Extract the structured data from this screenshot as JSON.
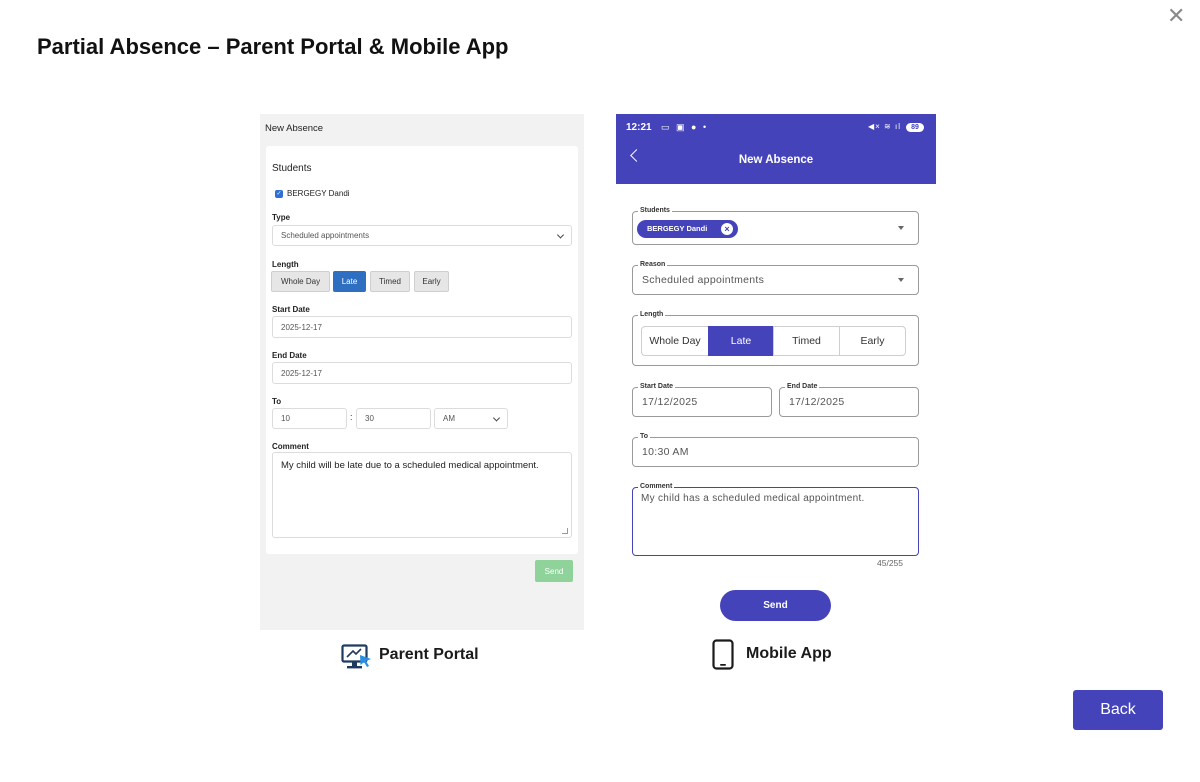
{
  "title": "Partial Absence – Parent Portal & Mobile App",
  "close_icon": "close-x-icon",
  "portal": {
    "heading": "New Absence",
    "students_label": "Students",
    "student_name": "BERGEGY Dandi",
    "type_label": "Type",
    "type_value": "Scheduled appointments",
    "length_label": "Length",
    "length_options": [
      "Whole Day",
      "Late",
      "Timed",
      "Early"
    ],
    "length_selected": "Late",
    "start_label": "Start Date",
    "start_value": "2025-12-17",
    "end_label": "End Date",
    "end_value": "2025-12-17",
    "to_label": "To",
    "to_hour": "10",
    "to_minute": "30",
    "to_ampm": "AM",
    "comment_label": "Comment",
    "comment_value": "My child will be late due to a scheduled medical appointment.",
    "send_label": "Send",
    "caption": "Parent Portal",
    "accent": "#2f6fc1",
    "send_color": "#8fd39a"
  },
  "mobile": {
    "status_time": "12:21",
    "battery": "89",
    "heading": "New Absence",
    "students_label": "Students",
    "student_chip": "BERGEGY Dandi",
    "reason_label": "Reason",
    "reason_value": "Scheduled appointments",
    "length_label": "Length",
    "length_options": [
      "Whole Day",
      "Late",
      "Timed",
      "Early"
    ],
    "length_selected": "Late",
    "start_label": "Start Date",
    "start_value": "17/12/2025",
    "end_label": "End Date",
    "end_value": "17/12/2025",
    "to_label": "To",
    "to_value": "10:30 AM",
    "comment_label": "Comment",
    "comment_value": "My child has a scheduled medical appointment.",
    "counter": "45/255",
    "send_label": "Send",
    "caption": "Mobile App",
    "accent": "#4543ba"
  },
  "back_label": "Back"
}
